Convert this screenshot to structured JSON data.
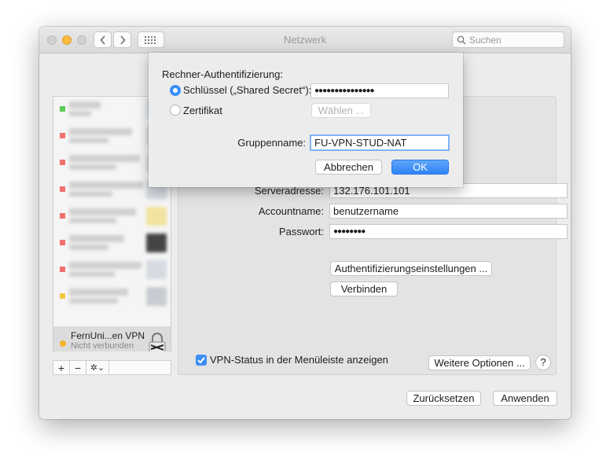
{
  "window": {
    "title": "Netzwerk"
  },
  "toolbar": {
    "search_placeholder": "Suchen"
  },
  "sidebar": {
    "blurred_dot_colors": [
      "#5ccd5c",
      "#f07070",
      "#f07070",
      "#f07070",
      "#f07070",
      "#f07070",
      "#f07070",
      "#f6c544"
    ],
    "active_service": {
      "name": "FernUni...en VPN",
      "status": "Nicht verbunden",
      "status_color": "#f5b22b"
    },
    "toolbar": {
      "add": "+",
      "remove": "−",
      "action": "✲⌄"
    }
  },
  "sheet": {
    "heading": "Rechner-Authentifizierung:",
    "option_secret_label": "Schlüssel („Shared Secret“):",
    "option_secret_value": "●●●●●●●●●●●●●●●",
    "option_cert_label": "Zertifikat",
    "choose_button": "Wählen ...",
    "group_label": "Gruppenname:",
    "group_value": "FU-VPN-STUD-NAT",
    "cancel_button": "Abbrechen",
    "ok_button": "OK"
  },
  "panel": {
    "server_label": "Serveradresse:",
    "server_value": "132.176.101.101",
    "account_label": "Accountname:",
    "account_value": "benutzername",
    "password_label": "Passwort:",
    "password_value": "●●●●●●●●",
    "auth_settings_button": "Authentifizierungseinstellungen ...",
    "connect_button": "Verbinden",
    "show_status_label": "VPN-Status in der Menüleiste anzeigen",
    "more_options_button": "Weitere Optionen ...",
    "help_button": "?"
  },
  "footer": {
    "revert_button": "Zurücksetzen",
    "apply_button": "Anwenden"
  },
  "colors": {
    "accent": "#3a8ef6",
    "minimize": "#fdbc40"
  }
}
